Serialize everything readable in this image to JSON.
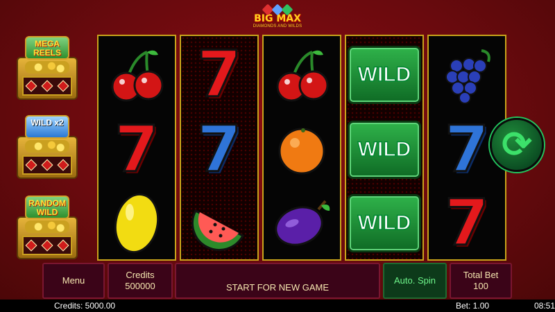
{
  "logo": {
    "title": "BIG MAX",
    "subtitle": "DIAMONDS AND WILDS",
    "gem_colors": [
      "#e03030",
      "#60a0ff",
      "#30c060"
    ]
  },
  "features": [
    {
      "name": "mega-reels",
      "label": "MEGA REELS",
      "style": "green"
    },
    {
      "name": "wild-x2",
      "label": "WILD x2",
      "style": "blue"
    },
    {
      "name": "random-wild",
      "label": "RANDOM WILD",
      "style": "green"
    }
  ],
  "reels": [
    [
      "cherry",
      "seven-red",
      "lemon"
    ],
    [
      "seven-red",
      "seven-blue",
      "watermelon"
    ],
    [
      "cherry",
      "orange",
      "plum"
    ],
    [
      "wild",
      "wild",
      "wild"
    ],
    [
      "grapes",
      "seven-blue",
      "seven-red"
    ]
  ],
  "wild_label": "WILD",
  "seven_glyph": "7",
  "spin_icon": "refresh-icon",
  "buttons": {
    "menu": "Menu",
    "credits_label": "Credits",
    "credits_value": "500000",
    "message": "START FOR NEW GAME",
    "autospin": "Auto. Spin",
    "totalbet_label": "Total Bet",
    "totalbet_value": "100"
  },
  "status": {
    "credits": "Credits: 5000.00",
    "bet": "Bet: 1.00",
    "clock": "08:51"
  }
}
